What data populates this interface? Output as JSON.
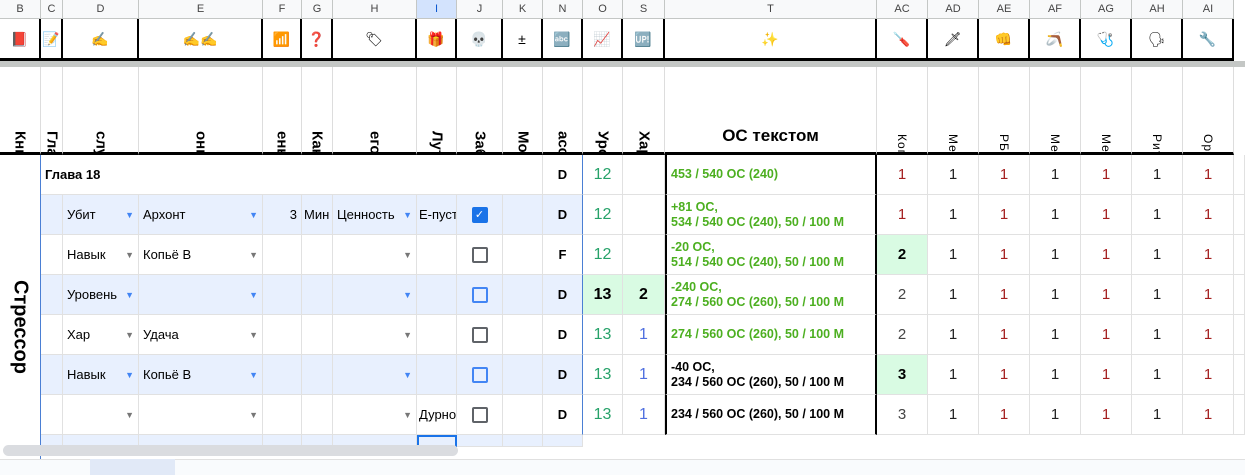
{
  "columns": [
    {
      "letter": "B",
      "icon": "📕",
      "icon_name": "book-icon",
      "header": "Книга"
    },
    {
      "letter": "C",
      "icon": "📝",
      "icon_name": "memo-icon",
      "header": "Глава"
    },
    {
      "letter": "D",
      "icon": "✍",
      "icon_name": "writing-hand-icon",
      "header": "случилось?"
    },
    {
      "letter": "E",
      "icon": "✍✍",
      "icon_name": "writing-hands-icon",
      "header": "онкретнее..."
    },
    {
      "letter": "F",
      "icon": "📶",
      "icon_name": "bars-icon",
      "header": "ень убитого"
    },
    {
      "letter": "G",
      "icon": "❓",
      "icon_name": "question-icon",
      "header": "Как убил"
    },
    {
      "letter": "H",
      "icon": "🏷",
      "icon_name": "tag-icon",
      "header": "егория Лута"
    },
    {
      "letter": "I",
      "icon": "🎁",
      "icon_name": "gift-icon",
      "header": "Лут"
    },
    {
      "letter": "J",
      "icon": "💀",
      "icon_name": "skull-icon",
      "header": "Забрал труп"
    },
    {
      "letter": "K",
      "icon": "±",
      "icon_name": "plus-minus-icon",
      "header": "Мод"
    },
    {
      "letter": "N",
      "icon": "🔤",
      "icon_name": "abcd-icon",
      "header": "асс Оружия"
    },
    {
      "letter": "O",
      "icon": "📈",
      "icon_name": "chart-icon",
      "header": "Уровень"
    },
    {
      "letter": "S",
      "icon": "🆙",
      "icon_name": "up-icon",
      "header": "Хар очки"
    },
    {
      "letter": "T",
      "icon": "✨",
      "icon_name": "sparkles-icon",
      "header": "ОС текстом"
    },
    {
      "letter": "AC",
      "icon": "🪛",
      "icon_name": "screwdriver-icon",
      "header": "Копьё В"
    },
    {
      "letter": "AD",
      "icon": "🗡",
      "icon_name": "dagger-icon",
      "header": "Меч В"
    },
    {
      "letter": "AE",
      "icon": "👊",
      "icon_name": "fist-icon",
      "header": "РБ"
    },
    {
      "letter": "AF",
      "icon": "🪃",
      "icon_name": "boomerang-icon",
      "header": "Метание"
    },
    {
      "letter": "AG",
      "icon": "🩺",
      "icon_name": "stethoscope-icon",
      "header": "Медик"
    },
    {
      "letter": "AH",
      "icon": "🗣",
      "icon_name": "speaking-head-icon",
      "header": "Риторик"
    },
    {
      "letter": "AI",
      "icon": "🔧",
      "icon_name": "wrench-icon",
      "header": "Оружейник"
    }
  ],
  "book": "Стрессор",
  "chapter": "Глава 18",
  "chapter_row": {
    "class": "D",
    "level": "12",
    "os": "453 / 540 ОС (240)",
    "skills": [
      "1",
      "1",
      "1",
      "1",
      "1",
      "1",
      "1"
    ]
  },
  "rows": [
    {
      "what": "Убит",
      "detail": "Архонт",
      "killed_level": "3",
      "how": "Мин",
      "loot_cat": "Ценность",
      "loot": "Е-пуст",
      "checked": true,
      "class": "D",
      "level": "12",
      "points": "",
      "os": [
        "+81 ОС,",
        "534 / 540 ОС (240), 50 / 100 М"
      ],
      "os_black": false,
      "skills": [
        "1",
        "1",
        "1",
        "1",
        "1",
        "1",
        "1"
      ]
    },
    {
      "what": "Навык",
      "detail": "Копьё В",
      "killed_level": "",
      "how": "",
      "loot_cat": "",
      "loot": "",
      "checked": false,
      "class": "F",
      "level": "12",
      "points": "",
      "os": [
        "-20 ОС,",
        "514 / 540 ОС (240), 50 / 100 М"
      ],
      "os_black": false,
      "skills": [
        "2",
        "1",
        "1",
        "1",
        "1",
        "1",
        "1"
      ]
    },
    {
      "what": "Уровень",
      "detail": "",
      "killed_level": "",
      "how": "",
      "loot_cat": "",
      "loot": "",
      "checked": false,
      "class": "D",
      "level": "13",
      "points": "2",
      "os": [
        "-240 ОС,",
        "274 / 560 ОС (260), 50 / 100 М"
      ],
      "os_black": false,
      "skills": [
        "2",
        "1",
        "1",
        "1",
        "1",
        "1",
        "1"
      ]
    },
    {
      "what": "Хар",
      "detail": "Удача",
      "killed_level": "",
      "how": "",
      "loot_cat": "",
      "loot": "",
      "checked": false,
      "class": "D",
      "level": "13",
      "points": "1",
      "os": [
        "274 / 560 ОС (260), 50 / 100 М"
      ],
      "os_black": false,
      "skills": [
        "2",
        "1",
        "1",
        "1",
        "1",
        "1",
        "1"
      ]
    },
    {
      "what": "Навык",
      "detail": "Копьё В",
      "killed_level": "",
      "how": "",
      "loot_cat": "",
      "loot": "",
      "checked": false,
      "class": "D",
      "level": "13",
      "points": "1",
      "os": [
        "-40 ОС,",
        "234 / 560 ОС (260), 50 / 100 М"
      ],
      "os_black": true,
      "skills": [
        "3",
        "1",
        "1",
        "1",
        "1",
        "1",
        "1"
      ]
    },
    {
      "what": "",
      "detail": "",
      "killed_level": "",
      "how": "",
      "loot_cat": "",
      "loot": "Дурно",
      "checked": false,
      "class": "D",
      "level": "13",
      "points": "1",
      "os": [
        "234 / 560 ОС (260), 50 / 100 М"
      ],
      "os_black": true,
      "skills": [
        "3",
        "1",
        "1",
        "1",
        "1",
        "1",
        "1"
      ]
    }
  ]
}
